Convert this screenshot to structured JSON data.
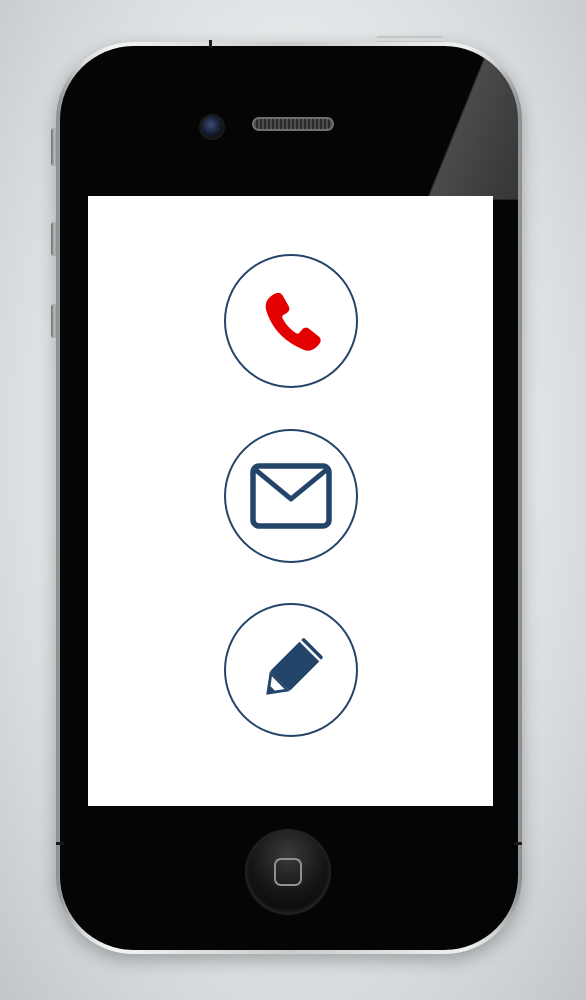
{
  "device": {
    "type": "smartphone",
    "hardware": {
      "camera_icon": "front-camera-icon",
      "speaker_icon": "earpiece-speaker-icon",
      "home_button_icon": "home-square-icon"
    }
  },
  "screen": {
    "background": "#ffffff",
    "actions": [
      {
        "name": "call",
        "icon": "phone-icon",
        "icon_color": "#e30000",
        "ring_color": "#24456a"
      },
      {
        "name": "email",
        "icon": "envelope-icon",
        "icon_color": "#24456a",
        "ring_color": "#24456a"
      },
      {
        "name": "write",
        "icon": "pencil-icon",
        "icon_color": "#24456a",
        "ring_color": "#24456a"
      }
    ]
  }
}
